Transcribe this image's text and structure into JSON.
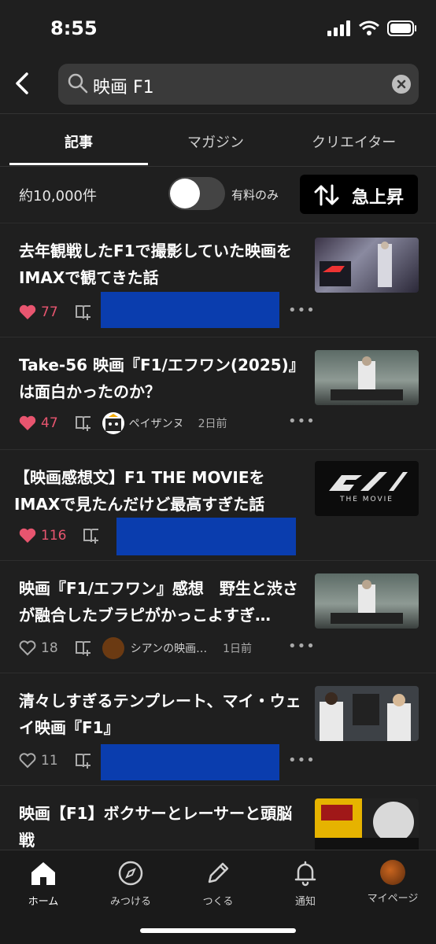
{
  "status_bar": {
    "time": "8:55"
  },
  "search": {
    "query": "映画 F1"
  },
  "tabs": [
    {
      "label": "記事",
      "active": true
    },
    {
      "label": "マガジン",
      "active": false
    },
    {
      "label": "クリエイター",
      "active": false
    }
  ],
  "filter": {
    "result_count": "約10,000件",
    "paid_only_label": "有料のみ",
    "paid_only_on": false,
    "sort_label": "急上昇"
  },
  "articles": [
    {
      "title": "去年観戦したF1で撮影していた映画をIMAXで観てきた話",
      "likes": "77",
      "liked": true,
      "author": "",
      "time": ""
    },
    {
      "title": "Take-56 映画『F1/エフワン(2025)』は面白かったのか？",
      "likes": "47",
      "liked": true,
      "author": "ペイザンヌ",
      "time": "2日前"
    },
    {
      "title": "【映画感想文】F1 THE MOVIEをIMAXで見たんだけど最高すぎた話",
      "likes": "116",
      "liked": true,
      "author": "",
      "time": "",
      "thumb_text": "THE MOVIE"
    },
    {
      "title": "映画『F1/エフワン』感想　野生と渋さが融合したブラピがかっこよすぎ…",
      "likes": "18",
      "liked": false,
      "author": "シアンの映画…",
      "time": "1日前"
    },
    {
      "title": "清々しすぎるテンプレート、マイ・ウェイ映画『F1』",
      "likes": "11",
      "liked": false,
      "author": "",
      "time": ""
    },
    {
      "title": "映画【F1】ボクサーとレーサーと頭脳戦",
      "likes": "",
      "liked": false,
      "author": "",
      "time": ""
    }
  ],
  "bottom_nav": [
    {
      "label": "ホーム",
      "icon": "home-icon",
      "active": true
    },
    {
      "label": "みつける",
      "icon": "compass-icon",
      "active": false
    },
    {
      "label": "つくる",
      "icon": "pencil-icon",
      "active": false
    },
    {
      "label": "通知",
      "icon": "bell-icon",
      "active": false
    },
    {
      "label": "マイページ",
      "icon": "avatar",
      "active": false
    }
  ],
  "colors": {
    "background": "#1f1f1f",
    "like_pink": "#e8556f",
    "redaction": "#0a3dae"
  }
}
